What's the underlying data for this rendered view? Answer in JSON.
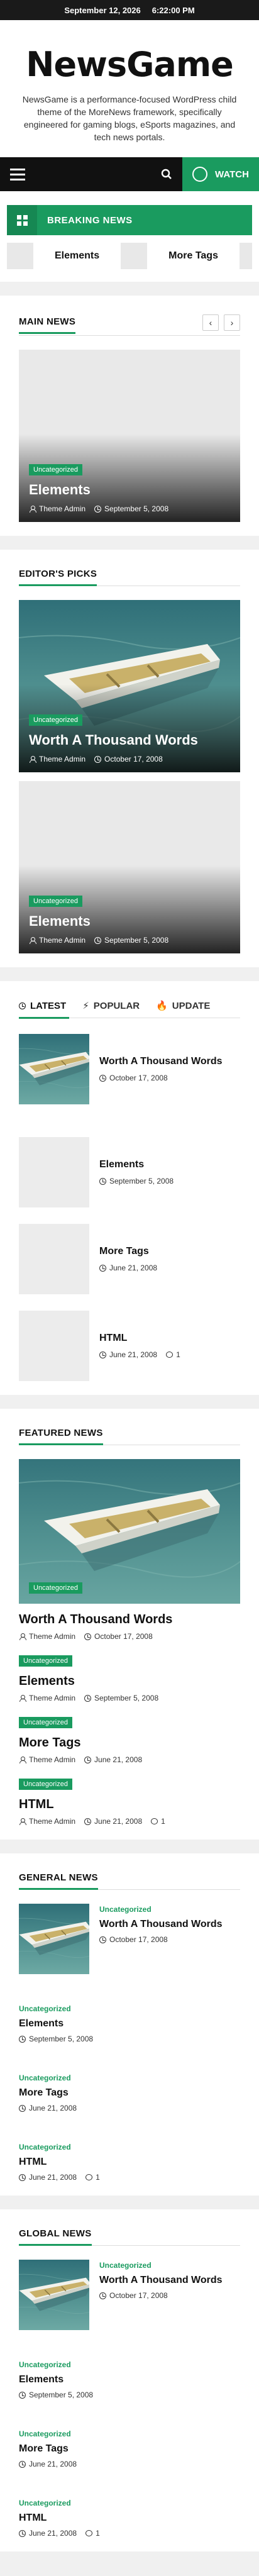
{
  "topbar": {
    "date": "September 12, 2026",
    "time": "6:22:00 PM"
  },
  "brand": {
    "title": "NewsGame",
    "tagline": "NewsGame is a performance-focused WordPress child theme of the MoreNews framework, specifically engineered for gaming blogs, eSports magazines, and tech news portals."
  },
  "nav": {
    "watch_label": "WATCH",
    "menu_icon": "hamburger-icon",
    "search_icon": "search-icon"
  },
  "breaking": {
    "label": "BREAKING NEWS",
    "items": [
      {
        "title": "Elements"
      },
      {
        "title": "More Tags"
      }
    ]
  },
  "main_news": {
    "title": "MAIN NEWS",
    "card": {
      "category": "Uncategorized",
      "title": "Elements",
      "author": "Theme Admin",
      "date": "September 5, 2008"
    }
  },
  "editors_picks": {
    "title": "EDITOR'S PICKS",
    "cards": [
      {
        "category": "Uncategorized",
        "title": "Worth A Thousand Words",
        "author": "Theme Admin",
        "date": "October 17, 2008"
      },
      {
        "category": "Uncategorized",
        "title": "Elements",
        "author": "Theme Admin",
        "date": "September 5, 2008"
      }
    ]
  },
  "tabs": {
    "labels": [
      "LATEST",
      "POPULAR",
      "UPDATE"
    ],
    "items": [
      {
        "title": "Worth A Thousand Words",
        "date": "October 17, 2008",
        "comments": ""
      },
      {
        "title": "Elements",
        "date": "September 5, 2008",
        "comments": ""
      },
      {
        "title": "More Tags",
        "date": "June 21, 2008",
        "comments": ""
      },
      {
        "title": "HTML",
        "date": "June 21, 2008",
        "comments": "1"
      }
    ]
  },
  "featured": {
    "title": "FEATURED NEWS",
    "main": {
      "category": "Uncategorized",
      "title": "Worth A Thousand Words",
      "author": "Theme Admin",
      "date": "October 17, 2008"
    },
    "items": [
      {
        "category": "Uncategorized",
        "title": "Elements",
        "author": "Theme Admin",
        "date": "September 5, 2008",
        "comments": ""
      },
      {
        "category": "Uncategorized",
        "title": "More Tags",
        "author": "Theme Admin",
        "date": "June 21, 2008",
        "comments": ""
      },
      {
        "category": "Uncategorized",
        "title": "HTML",
        "author": "Theme Admin",
        "date": "June 21, 2008",
        "comments": "1"
      }
    ]
  },
  "general": {
    "title": "GENERAL NEWS",
    "items": [
      {
        "category": "Uncategorized",
        "title": "Worth A Thousand Words",
        "date": "October 17, 2008",
        "comments": ""
      },
      {
        "category": "Uncategorized",
        "title": "Elements",
        "date": "September 5, 2008",
        "comments": ""
      },
      {
        "category": "Uncategorized",
        "title": "More Tags",
        "date": "June 21, 2008",
        "comments": ""
      },
      {
        "category": "Uncategorized",
        "title": "HTML",
        "date": "June 21, 2008",
        "comments": "1"
      }
    ]
  },
  "global": {
    "title": "GLOBAL NEWS",
    "items": [
      {
        "category": "Uncategorized",
        "title": "Worth A Thousand Words",
        "date": "October 17, 2008",
        "comments": ""
      },
      {
        "category": "Uncategorized",
        "title": "Elements",
        "date": "September 5, 2008",
        "comments": ""
      },
      {
        "category": "Uncategorized",
        "title": "More Tags",
        "date": "June 21, 2008",
        "comments": ""
      },
      {
        "category": "Uncategorized",
        "title": "HTML",
        "date": "June 21, 2008",
        "comments": "1"
      }
    ]
  },
  "colors": {
    "accent": "#1a9b5f",
    "dark": "#111111",
    "topbar": "#1a1a1a"
  }
}
